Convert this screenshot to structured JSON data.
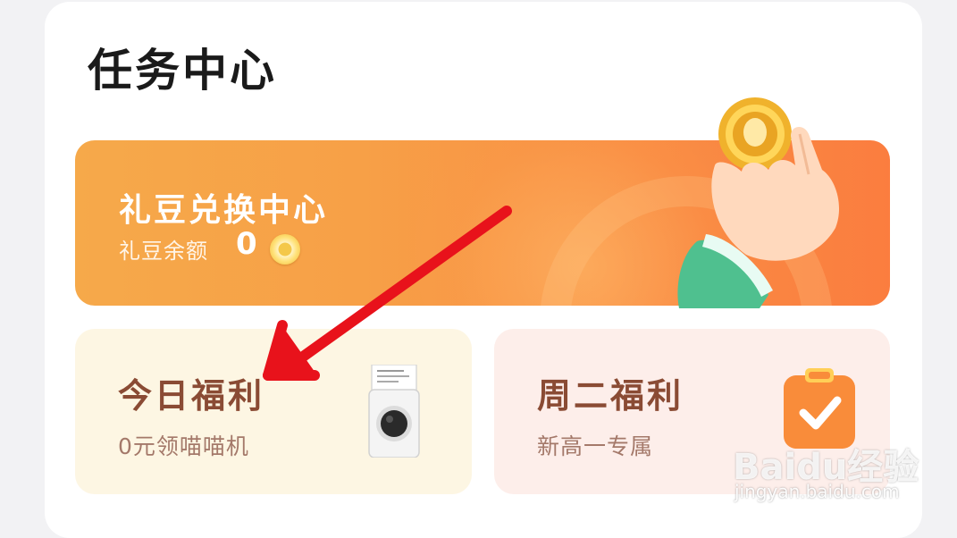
{
  "header": {
    "title": "任务中心"
  },
  "exchange": {
    "title": "礼豆兑换中心",
    "balance_label": "礼豆余额",
    "balance_value": "0",
    "icon": "bean-coin-icon"
  },
  "welfare": [
    {
      "title": "今日福利",
      "subtitle": "0元领喵喵机",
      "icon": "printer-icon"
    },
    {
      "title": "周二福利",
      "subtitle": "新高一专属",
      "icon": "clipboard-check-icon"
    }
  ],
  "watermark": {
    "logo": "Baidu经验",
    "url": "jingyan.baidu.com"
  },
  "colors": {
    "arrow": "#e8121b",
    "exchange_gradient_start": "#f6a94a",
    "exchange_gradient_end": "#fb7d3f",
    "today_bg": "#fdf6e3",
    "tuesday_bg": "#fdeeea",
    "card_title": "#8a4b34"
  }
}
